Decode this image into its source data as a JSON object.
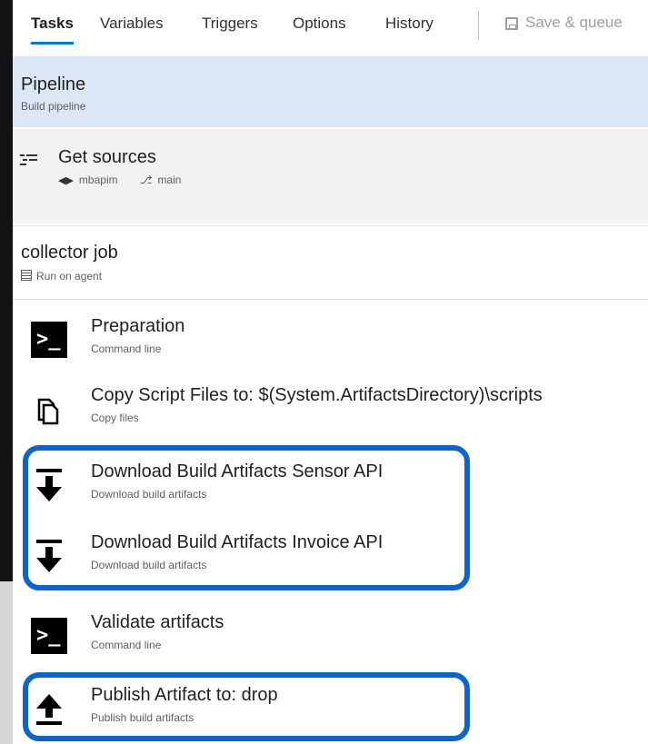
{
  "tabs": [
    {
      "label": "Tasks",
      "active": true
    },
    {
      "label": "Variables",
      "active": false
    },
    {
      "label": "Triggers",
      "active": false
    },
    {
      "label": "Options",
      "active": false
    },
    {
      "label": "History",
      "active": false
    }
  ],
  "toolbar": {
    "save_label": "Save & queue"
  },
  "pipeline": {
    "title": "Pipeline",
    "subtitle": "Build pipeline"
  },
  "sources": {
    "title": "Get sources",
    "repo": "mbapim",
    "branch": "main"
  },
  "job": {
    "title": "collector job",
    "subtitle": "Run on agent"
  },
  "tasks": [
    {
      "name": "Preparation",
      "type": "Command line",
      "icon": "command-line-icon"
    },
    {
      "name": "Copy Script Files to: $(System.ArtifactsDirectory)\\scripts",
      "type": "Copy files",
      "icon": "copy-files-icon"
    },
    {
      "name": "Download Build Artifacts Sensor API",
      "type": "Download build artifacts",
      "icon": "download-icon"
    },
    {
      "name": "Download Build Artifacts Invoice API",
      "type": "Download build artifacts",
      "icon": "download-icon"
    },
    {
      "name": "Validate artifacts",
      "type": "Command line",
      "icon": "command-line-icon"
    },
    {
      "name": "Publish Artifact to: drop",
      "type": "Publish build artifacts",
      "icon": "upload-icon"
    }
  ],
  "colors": {
    "accent": "#0078d4",
    "highlight": "#1063c8",
    "pipeline_bg": "#dbe7f4"
  }
}
